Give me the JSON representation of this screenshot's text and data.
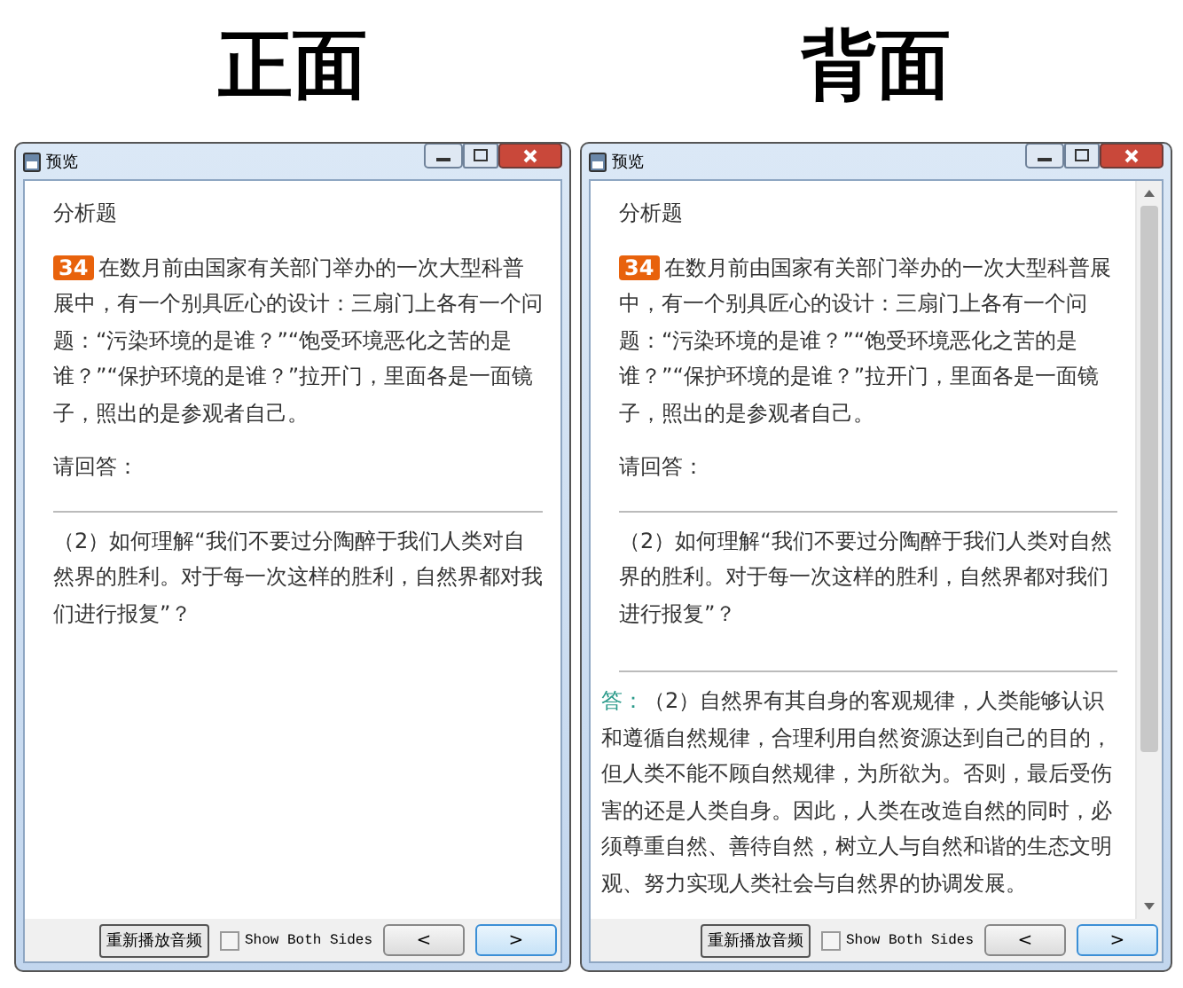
{
  "panels": [
    {
      "heading": "正面",
      "window": {
        "title": "预览"
      },
      "scrollbar": false,
      "section_title": "分析题",
      "question_number": "34",
      "question_text": "在数月前由国家有关部门举办的一次大型科普展中，有一个别具匠心的设计：三扇门上各有一个问题：“污染环境的是谁？”“饱受环境恶化之苦的是谁？”“保护环境的是谁？”拉开门，里面各是一面镜子，照出的是参观者自己。",
      "prompt": "请回答：",
      "sub_question": "（2）如何理解“我们不要过分陶醉于我们人类对自然界的胜利。对于每一次这样的胜利，自然界都对我们进行报复”？",
      "replay_button": "重新播放音频",
      "show_both_sides": {
        "label": "Show Both Sides",
        "checked": false
      },
      "nav_buttons": [
        {
          "label": "<",
          "focused": false
        },
        {
          "label": ">",
          "focused": true
        }
      ]
    },
    {
      "heading": "背面",
      "window": {
        "title": "预览"
      },
      "scrollbar": true,
      "section_title": "分析题",
      "question_number": "34",
      "question_text": "在数月前由国家有关部门举办的一次大型科普展中，有一个别具匠心的设计：三扇门上各有一个问题：“污染环境的是谁？”“饱受环境恶化之苦的是谁？”“保护环境的是谁？”拉开门，里面各是一面镜子，照出的是参观者自己。",
      "prompt": "请回答：",
      "sub_question": "（2）如何理解“我们不要过分陶醉于我们人类对自然界的胜利。对于每一次这样的胜利，自然界都对我们进行报复”？",
      "answer": {
        "label": "答：",
        "text": "（2）自然界有其自身的客观规律，人类能够认识和遵循自然规律，合理利用自然资源达到自己的目的，但人类不能不顾自然规律，为所欲为。否则，最后受伤害的还是人类自身。因此，人类在改造自然的同时，必须尊重自然、善待自然，树立人与自然和谐的生态文明观、努力实现人类社会与自然界的协调发展。"
      },
      "replay_button": "重新播放音频",
      "show_both_sides": {
        "label": "Show Both Sides",
        "checked": false
      },
      "nav_buttons": [
        {
          "label": "<",
          "focused": false
        },
        {
          "label": ">",
          "focused": true
        }
      ]
    }
  ]
}
